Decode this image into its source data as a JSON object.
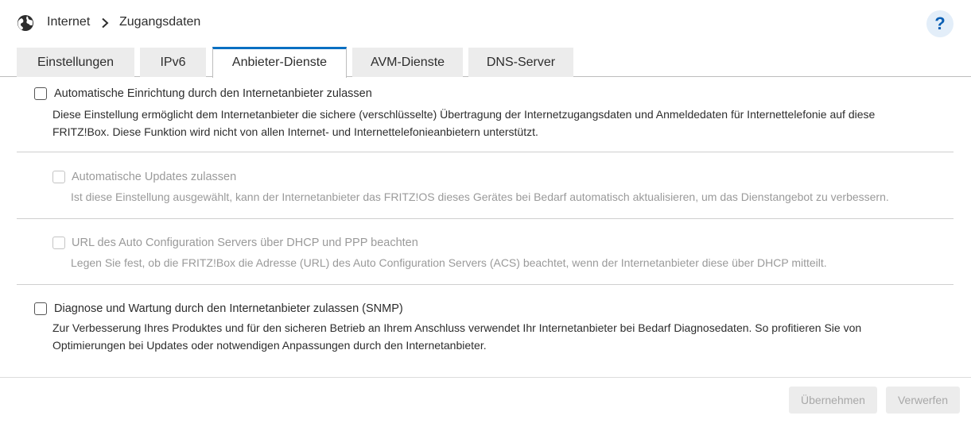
{
  "breadcrumb": {
    "items": [
      "Internet",
      "Zugangsdaten"
    ]
  },
  "help": {
    "label": "?"
  },
  "tabs": [
    {
      "label": "Einstellungen",
      "active": false
    },
    {
      "label": "IPv6",
      "active": false
    },
    {
      "label": "Anbieter-Dienste",
      "active": true
    },
    {
      "label": "AVM-Dienste",
      "active": false
    },
    {
      "label": "DNS-Server",
      "active": false
    }
  ],
  "options": [
    {
      "label": "Automatische Einrichtung durch den Internetanbieter zulassen",
      "checked": false,
      "disabled": false,
      "description_lines": [
        "Diese Einstellung ermöglicht dem Internetanbieter die sichere (verschlüsselte) Übertragung der Internetzugangsdaten und Anmeldedaten für Internettelefonie auf diese",
        "FRITZ!Box. Diese Funktion wird nicht von allen Internet- und Internettelefonieanbietern unterstützt."
      ]
    },
    {
      "label": "Automatische Updates zulassen",
      "checked": false,
      "disabled": true,
      "description_lines": [
        "Ist diese Einstellung ausgewählt, kann der Internetanbieter das FRITZ!OS dieses Gerätes bei Bedarf automatisch aktualisieren, um das Dienstangebot zu verbessern."
      ]
    },
    {
      "label": "URL des Auto Configuration Servers über DHCP und PPP beachten",
      "checked": false,
      "disabled": true,
      "description_lines": [
        "Legen Sie fest, ob die FRITZ!Box die Adresse (URL) des Auto Configuration Servers (ACS) beachtet, wenn der Internetanbieter diese über DHCP mitteilt."
      ]
    },
    {
      "label": "Diagnose und Wartung durch den Internetanbieter zulassen (SNMP)",
      "checked": false,
      "disabled": false,
      "description_lines": [
        "Zur Verbesserung Ihres Produktes und für den sicheren Betrieb an Ihrem Anschluss verwendet Ihr Internetanbieter bei Bedarf Diagnosedaten. So profitieren Sie von",
        "Optimierungen bei Updates oder notwendigen Anpassungen durch den Internetanbieter."
      ]
    }
  ],
  "buttons": {
    "apply": "Übernehmen",
    "discard": "Verwerfen"
  },
  "colors": {
    "accent": "#0a6fc2",
    "help_bg": "#e3eef9",
    "disabled_text": "#9a9a9a"
  },
  "icons": {
    "location": "globe-icon",
    "separator": "chevron-right-icon",
    "help": "help-icon"
  }
}
